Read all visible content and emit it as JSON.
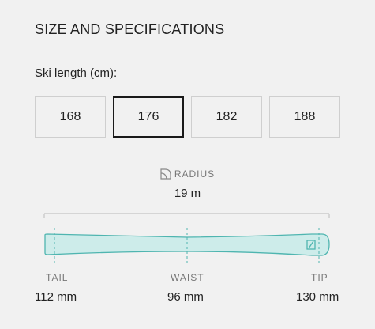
{
  "section_title": "SIZE AND SPECIFICATIONS",
  "length_label": "Ski length (cm):",
  "sizes": [
    {
      "label": "168",
      "selected": false
    },
    {
      "label": "176",
      "selected": true
    },
    {
      "label": "182",
      "selected": false
    },
    {
      "label": "188",
      "selected": false
    }
  ],
  "radius": {
    "label": "RADIUS",
    "value": "19 m",
    "icon": "radius-icon"
  },
  "dimensions": {
    "tail": {
      "label": "TAIL",
      "value": "112 mm"
    },
    "waist": {
      "label": "WAIST",
      "value": "96 mm"
    },
    "tip": {
      "label": "TIP",
      "value": "130 mm"
    }
  },
  "colors": {
    "ski_fill": "#cdecea",
    "ski_stroke": "#4fb5b0",
    "selected_border": "#1a1a1a"
  }
}
